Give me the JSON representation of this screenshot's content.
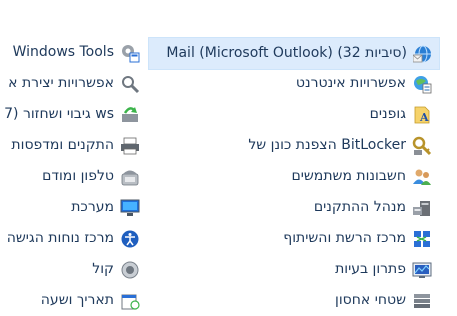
{
  "right_column": [
    {
      "label": "Mail (Microsoft Outlook) (32 סיביות)",
      "icon": "mail-icon"
    },
    {
      "label": "אפשרויות אינטרנט",
      "icon": "internet-options-icon"
    },
    {
      "label": "גופנים",
      "icon": "fonts-icon"
    },
    {
      "label": "הצפנת כונן של BitLocker",
      "icon": "bitlocker-icon"
    },
    {
      "label": "חשבונות משתמשים",
      "icon": "user-accounts-icon"
    },
    {
      "label": "מנהל ההתקנים",
      "icon": "device-manager-icon"
    },
    {
      "label": "מרכז הרשת והשיתוף",
      "icon": "network-center-icon"
    },
    {
      "label": "פתרון בעיות",
      "icon": "troubleshooting-icon"
    },
    {
      "label": "שטחי אחסון",
      "icon": "storage-spaces-icon"
    }
  ],
  "left_column": [
    {
      "label": "Windows Tools",
      "icon": "windows-tools-icon"
    },
    {
      "label": "אפשרויות יצירת א",
      "icon": "indexing-options-icon"
    },
    {
      "label": "גיבוי ושחזור (7 ws",
      "icon": "backup-restore-icon"
    },
    {
      "label": "התקנים ומדפסות",
      "icon": "devices-printers-icon"
    },
    {
      "label": "טלפון ומודם",
      "icon": "phone-modem-icon"
    },
    {
      "label": "מערכת",
      "icon": "system-icon"
    },
    {
      "label": "מרכז נוחות הגישה",
      "icon": "ease-of-access-icon"
    },
    {
      "label": "קול",
      "icon": "sound-icon"
    },
    {
      "label": "תאריך ושעה",
      "icon": "date-time-icon"
    }
  ],
  "colors": {
    "link": "#1e395b",
    "selected_bg": "#dcebfc",
    "selected_border": "#cde4fa"
  }
}
